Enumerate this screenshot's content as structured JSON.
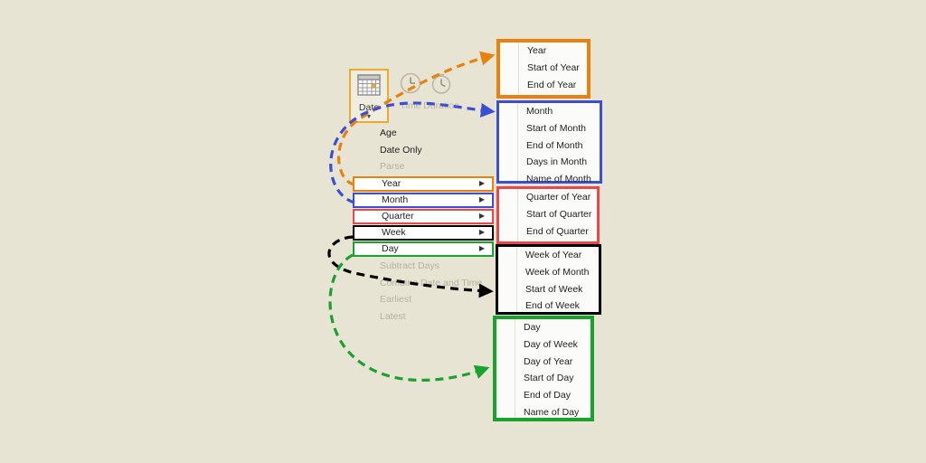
{
  "background_color": "#e8e4d4",
  "ribbon": {
    "buttons": [
      {
        "label": "Date",
        "icon": "calendar-icon",
        "enabled": true,
        "has_caret": true,
        "highlight_color": "#f0a830"
      },
      {
        "label": "Time",
        "icon": "clock-icon",
        "enabled": false,
        "has_caret": false
      },
      {
        "label": "Duration",
        "icon": "stopwatch-icon",
        "enabled": false,
        "has_caret": false
      }
    ]
  },
  "menu": {
    "items": [
      {
        "label": "Age",
        "enabled": true,
        "submenu": false,
        "highlight": null
      },
      {
        "label": "Date Only",
        "enabled": true,
        "submenu": false,
        "highlight": null
      },
      {
        "label": "Parse",
        "enabled": false,
        "submenu": false,
        "highlight": null
      },
      {
        "label": "Year",
        "enabled": true,
        "submenu": true,
        "highlight": "#e8820c"
      },
      {
        "label": "Month",
        "enabled": true,
        "submenu": true,
        "highlight": "#3b4fd4"
      },
      {
        "label": "Quarter",
        "enabled": true,
        "submenu": true,
        "highlight": "#e8474b"
      },
      {
        "label": "Week",
        "enabled": true,
        "submenu": true,
        "highlight": "#000000"
      },
      {
        "label": "Day",
        "enabled": true,
        "submenu": true,
        "highlight": "#17a32c"
      },
      {
        "label": "Subtract Days",
        "enabled": false,
        "submenu": false,
        "highlight": null
      },
      {
        "label": "Combine Date and Time",
        "enabled": false,
        "submenu": false,
        "highlight": null
      },
      {
        "label": "Earliest",
        "enabled": false,
        "submenu": false,
        "highlight": null
      },
      {
        "label": "Latest",
        "enabled": false,
        "submenu": false,
        "highlight": null
      }
    ],
    "submenu_arrow_glyph": "▶"
  },
  "panels": {
    "year": {
      "border_color": "#e8820c",
      "items": [
        "Year",
        "Start of Year",
        "End of Year"
      ]
    },
    "month": {
      "border_color": "#3b4fd4",
      "items": [
        "Month",
        "Start of Month",
        "End of Month",
        "Days in Month",
        "Name of Month"
      ]
    },
    "quarter": {
      "border_color": "#e8474b",
      "items": [
        "Quarter of Year",
        "Start of Quarter",
        "End of Quarter"
      ]
    },
    "week": {
      "border_color": "#000000",
      "items": [
        "Week of Year",
        "Week of Month",
        "Start of Week",
        "End of Week"
      ]
    },
    "day": {
      "border_color": "#17a32c",
      "items": [
        "Day",
        "Day of Week",
        "Day of Year",
        "Start of Day",
        "End of Day",
        "Name of Day"
      ]
    }
  },
  "connectors": [
    {
      "name": "year-connector",
      "color": "#e8820c",
      "from": "menu-item-year",
      "to": "panel-year"
    },
    {
      "name": "month-connector",
      "color": "#3b4fd4",
      "from": "menu-item-month",
      "to": "panel-month"
    },
    {
      "name": "week-connector",
      "color": "#000000",
      "from": "menu-item-week",
      "to": "panel-week"
    },
    {
      "name": "day-connector",
      "color": "#17a32c",
      "from": "menu-item-day",
      "to": "panel-day"
    }
  ]
}
